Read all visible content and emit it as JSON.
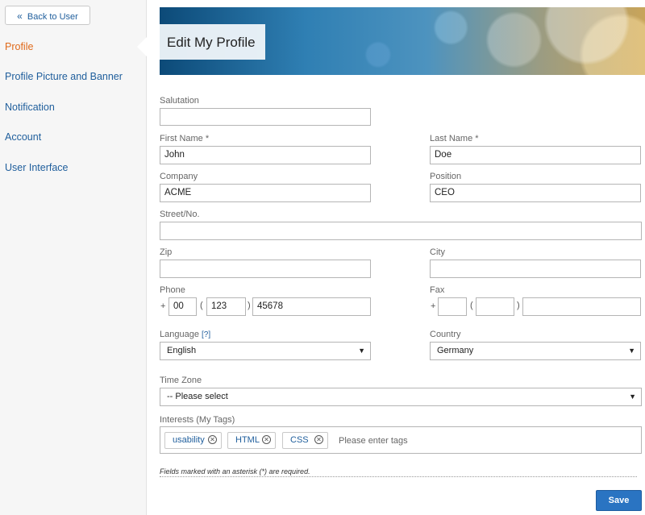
{
  "sidebar": {
    "back_label": "Back to User",
    "items": [
      {
        "label": "Profile",
        "active": true
      },
      {
        "label": "Profile Picture and Banner"
      },
      {
        "label": "Notification"
      },
      {
        "label": "Account"
      },
      {
        "label": "User Interface"
      }
    ]
  },
  "header": {
    "title": "Edit My Profile"
  },
  "form": {
    "salutation": {
      "label": "Salutation",
      "value": ""
    },
    "first_name": {
      "label": "First Name *",
      "value": "John"
    },
    "last_name": {
      "label": "Last Name *",
      "value": "Doe"
    },
    "company": {
      "label": "Company",
      "value": "ACME"
    },
    "position": {
      "label": "Position",
      "value": "CEO"
    },
    "street": {
      "label": "Street/No.",
      "value": ""
    },
    "zip": {
      "label": "Zip",
      "value": ""
    },
    "city": {
      "label": "City",
      "value": ""
    },
    "phone": {
      "label": "Phone",
      "prefix": "+",
      "country": "00",
      "area": "123",
      "number": "45678",
      "open_paren": "(",
      "close_paren": ")"
    },
    "fax": {
      "label": "Fax",
      "prefix": "+",
      "country": "",
      "area": "",
      "number": "",
      "open_paren": "(",
      "close_paren": ")"
    },
    "language": {
      "label": "Language",
      "hint": "[?]",
      "value": "English"
    },
    "country": {
      "label": "Country",
      "value": "Germany"
    },
    "timezone": {
      "label": "Time Zone",
      "value": "-- Please select"
    },
    "interests": {
      "label": "Interests (My Tags)",
      "tags": [
        "usability",
        "HTML",
        "CSS"
      ],
      "placeholder": "Please enter tags"
    },
    "required_note": "Fields marked with an asterisk (*) are required.",
    "save_label": "Save"
  },
  "colors": {
    "accent": "#2a74c2",
    "active_nav": "#e06a1b",
    "link": "#1f5e9c"
  },
  "icons": {
    "back": "double-chevron-left-icon",
    "dropdown": "caret-down-icon",
    "tag_remove": "circle-x-icon"
  }
}
